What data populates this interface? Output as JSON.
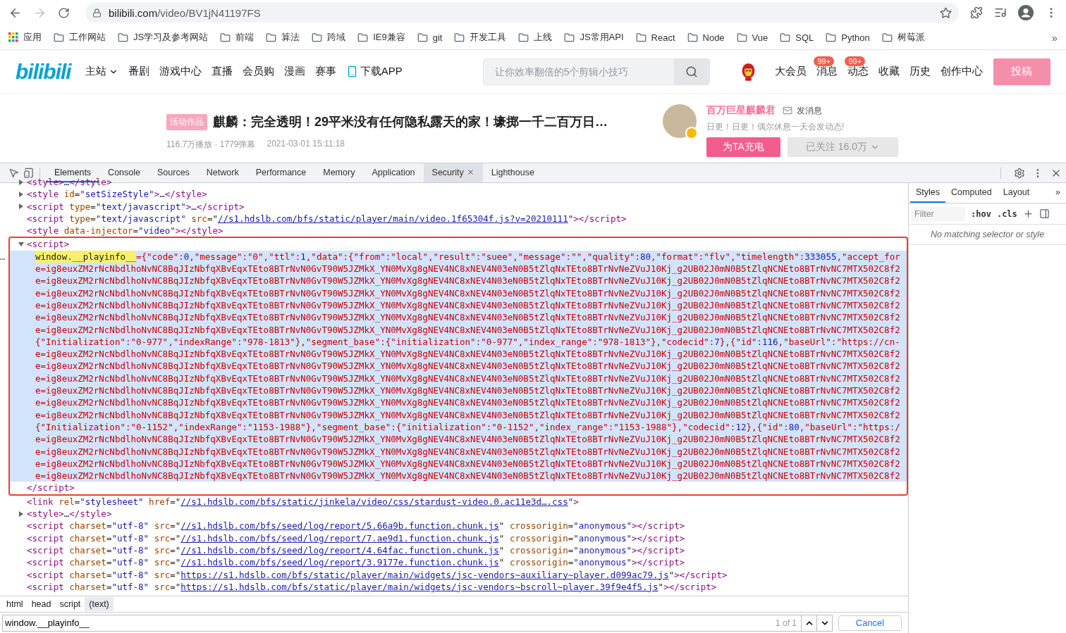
{
  "browser": {
    "address": {
      "host": "bilibili.com",
      "path": "/video/BV1jN41197FS"
    },
    "forward_disabled": true
  },
  "bookmarks": {
    "apps": "应用",
    "folders": [
      "工作网站",
      "JS学习及参考网站",
      "前端",
      "算法",
      "跨域",
      "IE9兼容",
      "git",
      "开发工具",
      "上线",
      "JS常用API",
      "React",
      "Node",
      "Vue",
      "SQL",
      "Python",
      "树莓派"
    ],
    "more": "»"
  },
  "site_header": {
    "logo": "bilibili",
    "nav": [
      {
        "label": "主站",
        "kind": "menu"
      },
      {
        "label": "番剧",
        "kind": "link"
      },
      {
        "label": "游戏中心",
        "kind": "link"
      },
      {
        "label": "直播",
        "kind": "link"
      },
      {
        "label": "会员购",
        "kind": "link"
      },
      {
        "label": "漫画",
        "kind": "link"
      },
      {
        "label": "赛事",
        "kind": "link"
      },
      {
        "label": "下载APP",
        "kind": "app"
      }
    ],
    "search": {
      "placeholder": "让你效率翻倍的5个剪辑小技巧"
    },
    "user_nav": [
      {
        "label": "大会员"
      },
      {
        "label": "消息",
        "badge": "99+"
      },
      {
        "label": "动态",
        "badge": "99+"
      },
      {
        "label": "收藏"
      },
      {
        "label": "历史"
      },
      {
        "label": "创作中心"
      }
    ],
    "upload_button": "投稿"
  },
  "video": {
    "tag": "活动作品",
    "title": "麒麟：完全透明！29平米没有任何隐私露天的家！壕掷一千二百万日…",
    "stats": "116.7万播放 · 1779弹幕",
    "date": "2021-03-01 15:11:18"
  },
  "uploader": {
    "name": "百万巨星麒麟君",
    "message": "发消息",
    "sign": "日更！日更！偶尔休息一天会发动态!",
    "charge_button": "为TA充电",
    "follow_button": "已关注 16.0万"
  },
  "devtools": {
    "tabs": [
      {
        "label": "Elements",
        "selected": true,
        "closable": false
      },
      {
        "label": "Console",
        "selected": false,
        "closable": false
      },
      {
        "label": "Sources",
        "selected": false,
        "closable": false
      },
      {
        "label": "Network",
        "selected": false,
        "closable": false
      },
      {
        "label": "Performance",
        "selected": false,
        "closable": false
      },
      {
        "label": "Memory",
        "selected": false,
        "closable": false
      },
      {
        "label": "Application",
        "selected": false,
        "closable": false
      },
      {
        "label": "Security",
        "selected": false,
        "closable": true
      },
      {
        "label": "Lighthouse",
        "selected": false,
        "closable": false
      }
    ]
  },
  "elements": {
    "lines_before": [
      {
        "expanded": false,
        "tokens": [
          {
            "kind": "tag",
            "text": "<style>"
          },
          {
            "kind": "text",
            "text": "…"
          },
          {
            "kind": "tag",
            "text": "</style>"
          }
        ]
      },
      {
        "expanded": false,
        "tokens": [
          {
            "kind": "tag",
            "text": "<style"
          },
          {
            "kind": "attr",
            "text": " id"
          },
          {
            "kind": "eq",
            "text": "="
          },
          {
            "kind": "val",
            "text": "\"setSizeStyle\""
          },
          {
            "kind": "tag",
            "text": ">"
          },
          {
            "kind": "text",
            "text": "…"
          },
          {
            "kind": "tag",
            "text": "</style>"
          }
        ]
      },
      {
        "expanded": false,
        "tokens": [
          {
            "kind": "tag",
            "text": "<script"
          },
          {
            "kind": "attr",
            "text": " type"
          },
          {
            "kind": "eq",
            "text": "="
          },
          {
            "kind": "val",
            "text": "\"text/javascript\""
          },
          {
            "kind": "tag",
            "text": ">"
          },
          {
            "kind": "text",
            "text": "…"
          },
          {
            "kind": "tag",
            "text": "</script>"
          }
        ]
      },
      {
        "tokens": [
          {
            "kind": "tag",
            "text": "<script"
          },
          {
            "kind": "attr",
            "text": " type"
          },
          {
            "kind": "eq",
            "text": "="
          },
          {
            "kind": "val",
            "text": "\"text/javascript\""
          },
          {
            "kind": "attr",
            "text": " src"
          },
          {
            "kind": "eq",
            "text": "=\""
          },
          {
            "kind": "link",
            "text": "//s1.hdslb.com/bfs/static/player/main/video.1f65304f.js?v=20210111"
          },
          {
            "kind": "eq",
            "text": "\""
          },
          {
            "kind": "tag",
            "text": "></script>"
          }
        ]
      },
      {
        "tokens": [
          {
            "kind": "tag",
            "text": "<style"
          },
          {
            "kind": "attr",
            "text": " data-injector"
          },
          {
            "kind": "eq",
            "text": "="
          },
          {
            "kind": "val",
            "text": "\"video\""
          },
          {
            "kind": "tag",
            "text": "></style>"
          }
        ]
      }
    ],
    "highlighted_script": {
      "selected": true,
      "gutter_mark": "…",
      "open": {
        "expanded": true,
        "tokens": [
          {
            "kind": "tag",
            "text": "<script>"
          }
        ]
      },
      "lines": [
        {
          "tokens": [
            {
              "kind": "match",
              "text": "window.__playinfo__"
            },
            {
              "kind": "str",
              "text": "={\"code\":"
            },
            {
              "kind": "num",
              "text": "0"
            },
            {
              "kind": "str",
              "text": ",\"message\":\"0\",\"ttl\":"
            },
            {
              "kind": "num",
              "text": "1"
            },
            {
              "kind": "str",
              "text": ",\"data\":{\"from\":\"local\",\"result\":\"suee\",\"message\":\"\",\"quality\":"
            },
            {
              "kind": "num",
              "text": "80"
            },
            {
              "kind": "str",
              "text": ",\"format\":\"flv\",\"timelength\":"
            },
            {
              "kind": "num",
              "text": "333055"
            },
            {
              "kind": "str",
              "text": ",\"accept_for"
            }
          ]
        },
        {
          "tokens": [
            {
              "kind": "str",
              "text": "e=ig8euxZM2rNcNbdlhoNvNC8BqJIzNbfqXBvEqxTEto8BTrNvN0GvT90W5JZMkX_YN0MvXg8gNEV4NC8xNEV4N03eN0B5tZlqNxTEto8BTrNvNeZVuJ10Kj_g2UB02J0mN0B5tZlqNCNEto8BTrNvNC7MTX502C8f2"
            }
          ]
        },
        {
          "tokens": [
            {
              "kind": "str",
              "text": "e=ig8euxZM2rNcNbdlhoNvNC8BqJIzNbfqXBvEqxTEto8BTrNvN0GvT90W5JZMkX_YN0MvXg8gNEV4NC8xNEV4N03eN0B5tZlqNxTEto8BTrNvNeZVuJ10Kj_g2UB02J0mN0B5tZlqNCNEto8BTrNvNC7MTX502C8f2"
            }
          ]
        },
        {
          "tokens": [
            {
              "kind": "str",
              "text": "e=ig8euxZM2rNcNbdlhoNvNC8BqJIzNbfqXBvEqxTEto8BTrNvN0GvT90W5JZMkX_YN0MvXg8gNEV4NC8xNEV4N03eN0B5tZlqNxTEto8BTrNvNeZVuJ10Kj_g2UB02J0mN0B5tZlqNCNEto8BTrNvNC7MTX502C8f2"
            }
          ]
        },
        {
          "tokens": [
            {
              "kind": "str",
              "text": "e=ig8euxZM2rNcNbdlhoNvNC8BqJIzNbfqXBvEqxTEto8BTrNvN0GvT90W5JZMkX_YN0MvXg8gNEV4NC8xNEV4N03eN0B5tZlqNxTEto8BTrNvNeZVuJ10Kj_g2UB02J0mN0B5tZlqNCNEto8BTrNvNC7MTX502C8f2"
            }
          ]
        },
        {
          "tokens": [
            {
              "kind": "str",
              "text": "e=ig8euxZM2rNcNbdlhoNvNC8BqJIzNbfqXBvEqxTEto8BTrNvN0GvT90W5JZMkX_YN0MvXg8gNEV4NC8xNEV4N03eN0B5tZlqNxTEto8BTrNvNeZVuJ10Kj_g2UB02J0mN0B5tZlqNCNEto8BTrNvNC7MTX502C8f2"
            }
          ]
        },
        {
          "tokens": [
            {
              "kind": "str",
              "text": "e=ig8euxZM2rNcNbdlhoNvNC8BqJIzNbfqXBvEqxTEto8BTrNvN0GvT90W5JZMkX_YN0MvXg8gNEV4NC8xNEV4N03eN0B5tZlqNxTEto8BTrNvNeZVuJ10Kj_g2UB02J0mN0B5tZlqNCNEto8BTrNvNC7MTX502C8f2"
            }
          ]
        },
        {
          "tokens": [
            {
              "kind": "str",
              "text": "{\"Initialization\":\"0-977\",\"indexRange\":\"978-1813\"},\"segment_base\":{\"initialization\":\"0-977\",\"index_range\":\"978-1813\"},\"codecid\":"
            },
            {
              "kind": "num",
              "text": "7"
            },
            {
              "kind": "str",
              "text": "},{\"id\":"
            },
            {
              "kind": "num",
              "text": "116"
            },
            {
              "kind": "str",
              "text": ",\"baseUrl\":\"https://cn-"
            }
          ]
        },
        {
          "tokens": [
            {
              "kind": "str",
              "text": "e=ig8euxZM2rNcNbdlhoNvNC8BqJIzNbfqXBvEqxTEto8BTrNvN0GvT90W5JZMkX_YN0MvXg8gNEV4NC8xNEV4N03eN0B5tZlqNxTEto8BTrNvNeZVuJ10Kj_g2UB02J0mN0B5tZlqNCNEto8BTrNvNC7MTX502C8f2"
            }
          ]
        },
        {
          "tokens": [
            {
              "kind": "str",
              "text": "e=ig8euxZM2rNcNbdlhoNvNC8BqJIzNbfqXBvEqxTEto8BTrNvN0GvT90W5JZMkX_YN0MvXg8gNEV4NC8xNEV4N03eN0B5tZlqNxTEto8BTrNvNeZVuJ10Kj_g2UB02J0mN0B5tZlqNCNEto8BTrNvNC7MTX502C8f2"
            }
          ]
        },
        {
          "tokens": [
            {
              "kind": "str",
              "text": "e=ig8euxZM2rNcNbdlhoNvNC8BqJIzNbfqXBvEqxTEto8BTrNvN0GvT90W5JZMkX_YN0MvXg8gNEV4NC8xNEV4N03eN0B5tZlqNxTEto8BTrNvNeZVuJ10Kj_g2UB02J0mN0B5tZlqNCNEto8BTrNvNC7MTX502C8f2"
            }
          ]
        },
        {
          "tokens": [
            {
              "kind": "str",
              "text": "e=ig8euxZM2rNcNbdlhoNvNC8BqJIzNbfqXBvEqxTEto8BTrNvN0GvT90W5JZMkX_YN0MvXg8gNEV4NC8xNEV4N03eN0B5tZlqNxTEto8BTrNvNeZVuJ10Kj_g2UB02J0mN0B5tZlqNCNEto8BTrNvNC7MTX502C8f2"
            }
          ]
        },
        {
          "tokens": [
            {
              "kind": "str",
              "text": "e=ig8euxZM2rNcNbdlhoNvNC8BqJIzNbfqXBvEqxTEto8BTrNvN0GvT90W5JZMkX_YN0MvXg8gNEV4NC8xNEV4N03eN0B5tZlqNxTEto8BTrNvNeZVuJ10Kj_g2UB02J0mN0B5tZlqNCNEto8BTrNvNC7MTX502C8f2"
            }
          ]
        },
        {
          "tokens": [
            {
              "kind": "str",
              "text": "e=ig8euxZM2rNcNbdlhoNvNC8BqJIzNbfqXBvEqxTEto8BTrNvN0GvT90W5JZMkX_YN0MvXg8gNEV4NC8xNEV4N03eN0B5tZlqNxTEto8BTrNvNeZVuJ10Kj_g2UB02J0mN0B5tZlqNCNEto8BTrNvNC7MTX502C8f2"
            }
          ]
        },
        {
          "tokens": [
            {
              "kind": "str",
              "text": "{\"Initialization\":\"0-1152\",\"indexRange\":\"1153-1988\"},\"segment_base\":{\"initialization\":\"0-1152\",\"index_range\":\"1153-1988\"},\"codecid\":"
            },
            {
              "kind": "num",
              "text": "12"
            },
            {
              "kind": "str",
              "text": "},{\"id\":"
            },
            {
              "kind": "num",
              "text": "80"
            },
            {
              "kind": "str",
              "text": ",\"baseUrl\":\"https:/"
            }
          ]
        },
        {
          "tokens": [
            {
              "kind": "str",
              "text": "e=ig8euxZM2rNcNbdlhoNvNC8BqJIzNbfqXBvEqxTEto8BTrNvN0GvT90W5JZMkX_YN0MvXg8gNEV4NC8xNEV4N03eN0B5tZlqNxTEto8BTrNvNeZVuJ10Kj_g2UB02J0mN0B5tZlqNCNEto8BTrNvNC7MTX502C8f2"
            }
          ]
        },
        {
          "tokens": [
            {
              "kind": "str",
              "text": "e=ig8euxZM2rNcNbdlhoNvNC8BqJIzNbfqXBvEqxTEto8BTrNvN0GvT90W5JZMkX_YN0MvXg8gNEV4NC8xNEV4N03eN0B5tZlqNxTEto8BTrNvNeZVuJ10Kj_g2UB02J0mN0B5tZlqNCNEto8BTrNvNC7MTX502C8f2"
            }
          ]
        },
        {
          "tokens": [
            {
              "kind": "str",
              "text": "e=ig8euxZM2rNcNbdlhoNvNC8BqJIzNbfqXBvEqxTEto8BTrNvN0GvT90W5JZMkX_YN0MvXg8gNEV4NC8xNEV4N03eN0B5tZlqNxTEto8BTrNvNeZVuJ10Kj_g2UB02J0mN0B5tZlqNCNEto8BTrNvNC7MTX502C8f2"
            }
          ]
        },
        {
          "tokens": [
            {
              "kind": "str",
              "text": "e=ig8euxZM2rNcNbdlhoNvNC8BqJIzNbfqXBvEqxTEto8BTrNvN0GvT90W5JZMkX_YN0MvXg8gNEV4NC8xNEV4N03eN0B5tZlqNxTEto8BTrNvNeZVuJ10Kj_g2UB02J0mN0B5tZlqNCNEto8BTrNvNC7MTX502C8f2"
            }
          ]
        }
      ],
      "close": {
        "tokens": [
          {
            "kind": "tag",
            "text": "</script>"
          }
        ]
      }
    },
    "lines_after": [
      {
        "tokens": [
          {
            "kind": "tag",
            "text": "<link"
          },
          {
            "kind": "attr",
            "text": " rel"
          },
          {
            "kind": "eq",
            "text": "="
          },
          {
            "kind": "val",
            "text": "\"stylesheet\""
          },
          {
            "kind": "attr",
            "text": " href"
          },
          {
            "kind": "eq",
            "text": "=\""
          },
          {
            "kind": "link",
            "text": "//s1.hdslb.com/bfs/static/jinkela/video/css/stardust-video.0.ac11e3d….css"
          },
          {
            "kind": "eq",
            "text": "\""
          },
          {
            "kind": "tag",
            "text": ">"
          }
        ]
      },
      {
        "expanded": false,
        "tokens": [
          {
            "kind": "tag",
            "text": "<style>"
          },
          {
            "kind": "text",
            "text": "…"
          },
          {
            "kind": "tag",
            "text": "</style>"
          }
        ]
      },
      {
        "tokens": [
          {
            "kind": "tag",
            "text": "<script"
          },
          {
            "kind": "attr",
            "text": " charset"
          },
          {
            "kind": "eq",
            "text": "="
          },
          {
            "kind": "val",
            "text": "\"utf-8\""
          },
          {
            "kind": "attr",
            "text": " src"
          },
          {
            "kind": "eq",
            "text": "=\""
          },
          {
            "kind": "link",
            "text": "//s1.hdslb.com/bfs/seed/log/report/5.66a9b.function.chunk.js"
          },
          {
            "kind": "eq",
            "text": "\""
          },
          {
            "kind": "attr",
            "text": " crossorigin"
          },
          {
            "kind": "eq",
            "text": "="
          },
          {
            "kind": "val",
            "text": "\"anonymous\""
          },
          {
            "kind": "tag",
            "text": "></script>"
          }
        ]
      },
      {
        "tokens": [
          {
            "kind": "tag",
            "text": "<script"
          },
          {
            "kind": "attr",
            "text": " charset"
          },
          {
            "kind": "eq",
            "text": "="
          },
          {
            "kind": "val",
            "text": "\"utf-8\""
          },
          {
            "kind": "attr",
            "text": " src"
          },
          {
            "kind": "eq",
            "text": "=\""
          },
          {
            "kind": "link",
            "text": "//s1.hdslb.com/bfs/seed/log/report/7.ae9d1.function.chunk.js"
          },
          {
            "kind": "eq",
            "text": "\""
          },
          {
            "kind": "attr",
            "text": " crossorigin"
          },
          {
            "kind": "eq",
            "text": "="
          },
          {
            "kind": "val",
            "text": "\"anonymous\""
          },
          {
            "kind": "tag",
            "text": "></script>"
          }
        ]
      },
      {
        "tokens": [
          {
            "kind": "tag",
            "text": "<script"
          },
          {
            "kind": "attr",
            "text": " charset"
          },
          {
            "kind": "eq",
            "text": "="
          },
          {
            "kind": "val",
            "text": "\"utf-8\""
          },
          {
            "kind": "attr",
            "text": " src"
          },
          {
            "kind": "eq",
            "text": "=\""
          },
          {
            "kind": "link",
            "text": "//s1.hdslb.com/bfs/seed/log/report/4.64fac.function.chunk.js"
          },
          {
            "kind": "eq",
            "text": "\""
          },
          {
            "kind": "attr",
            "text": " crossorigin"
          },
          {
            "kind": "eq",
            "text": "="
          },
          {
            "kind": "val",
            "text": "\"anonymous\""
          },
          {
            "kind": "tag",
            "text": "></script>"
          }
        ]
      },
      {
        "tokens": [
          {
            "kind": "tag",
            "text": "<script"
          },
          {
            "kind": "attr",
            "text": " charset"
          },
          {
            "kind": "eq",
            "text": "="
          },
          {
            "kind": "val",
            "text": "\"utf-8\""
          },
          {
            "kind": "attr",
            "text": " src"
          },
          {
            "kind": "eq",
            "text": "=\""
          },
          {
            "kind": "link",
            "text": "//s1.hdslb.com/bfs/seed/log/report/3.9177e.function.chunk.js"
          },
          {
            "kind": "eq",
            "text": "\""
          },
          {
            "kind": "attr",
            "text": " crossorigin"
          },
          {
            "kind": "eq",
            "text": "="
          },
          {
            "kind": "val",
            "text": "\"anonymous\""
          },
          {
            "kind": "tag",
            "text": "></script>"
          }
        ]
      },
      {
        "tokens": [
          {
            "kind": "tag",
            "text": "<script"
          },
          {
            "kind": "attr",
            "text": " charset"
          },
          {
            "kind": "eq",
            "text": "="
          },
          {
            "kind": "val",
            "text": "\"utf-8\""
          },
          {
            "kind": "attr",
            "text": " src"
          },
          {
            "kind": "eq",
            "text": "=\""
          },
          {
            "kind": "link",
            "text": "https://s1.hdslb.com/bfs/static/player/main/widgets/jsc-vendors~auxiliary~player.d099ac79.js"
          },
          {
            "kind": "eq",
            "text": "\""
          },
          {
            "kind": "tag",
            "text": "></script>"
          }
        ]
      },
      {
        "tokens": [
          {
            "kind": "tag",
            "text": "<script"
          },
          {
            "kind": "attr",
            "text": " charset"
          },
          {
            "kind": "eq",
            "text": "="
          },
          {
            "kind": "val",
            "text": "\"utf-8\""
          },
          {
            "kind": "attr",
            "text": " src"
          },
          {
            "kind": "eq",
            "text": "=\""
          },
          {
            "kind": "link",
            "text": "https://s1.hdslb.com/bfs/static/player/main/widgets/jsc-vendors~bscroll~player.39f9e4f5.js"
          },
          {
            "kind": "eq",
            "text": "\""
          },
          {
            "kind": "tag",
            "text": "></script>"
          }
        ]
      }
    ]
  },
  "breadcrumbs": [
    {
      "label": "html",
      "selected": false
    },
    {
      "label": "head",
      "selected": false
    },
    {
      "label": "script",
      "selected": false
    },
    {
      "label": "(text)",
      "selected": true
    }
  ],
  "search_bar": {
    "value": "window.__playinfo__",
    "count": "1 of 1",
    "cancel": "Cancel"
  },
  "styles_panel": {
    "tabs": [
      {
        "label": "Styles",
        "selected": true
      },
      {
        "label": "Computed",
        "selected": false
      },
      {
        "label": "Layout",
        "selected": false
      }
    ],
    "more": "»",
    "filter_placeholder": "Filter",
    "hov": ":hov",
    "cls": ".cls",
    "empty_message": "No matching selector or style"
  }
}
